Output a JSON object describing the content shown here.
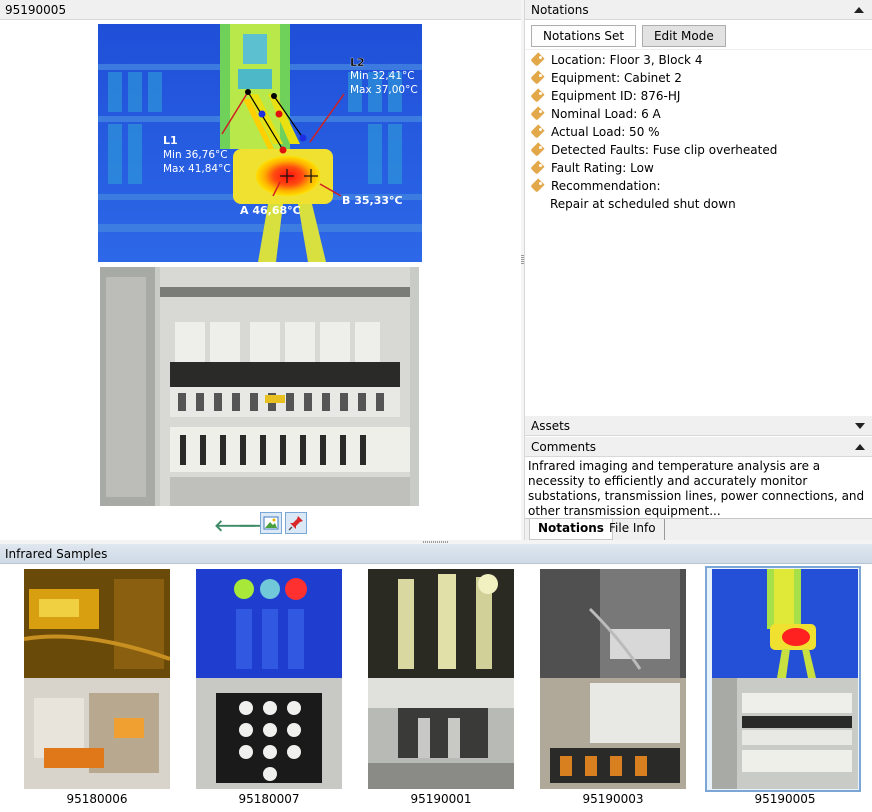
{
  "image_panel": {
    "title": "95190005",
    "annotations": {
      "l1_name": "L1",
      "l1_min": "Min  36,76°C",
      "l1_max": "Max  41,84°C",
      "l2_name": "L2",
      "l2_min": "Min  32,41°C",
      "l2_max": "Max  37,00°C",
      "a_label": "A 46,68°C",
      "b_label": "B 35,33°C"
    }
  },
  "notations": {
    "title": "Notations",
    "buttons": [
      "Notations Set",
      "Edit Mode"
    ],
    "items": [
      "Location: Floor 3, Block 4",
      "Equipment: Cabinet 2",
      "Equipment ID: 876-HJ",
      "Nominal Load: 6 A",
      "Actual Load: 50 %",
      "Detected Faults: Fuse clip overheated",
      "Fault Rating: Low",
      "Recommendation:"
    ],
    "recommendation_text": "Repair at scheduled shut down"
  },
  "assets": {
    "title": "Assets"
  },
  "comments": {
    "title": "Comments",
    "text": "Infrared imaging and temperature analysis are a necessity to efficiently and accurately monitor substations, transmission lines, power connections, and other transmission equipment..."
  },
  "tabs": [
    "Notations",
    "File Info"
  ],
  "samples": {
    "title": "Infrared Samples",
    "items": [
      "95180006",
      "95180007",
      "95190001",
      "95190003",
      "95190005"
    ],
    "selected_index": 4
  },
  "colors": {
    "accent": "#7ba6d6",
    "arrow": "#3f8a66",
    "tag": "#e2a84a"
  }
}
